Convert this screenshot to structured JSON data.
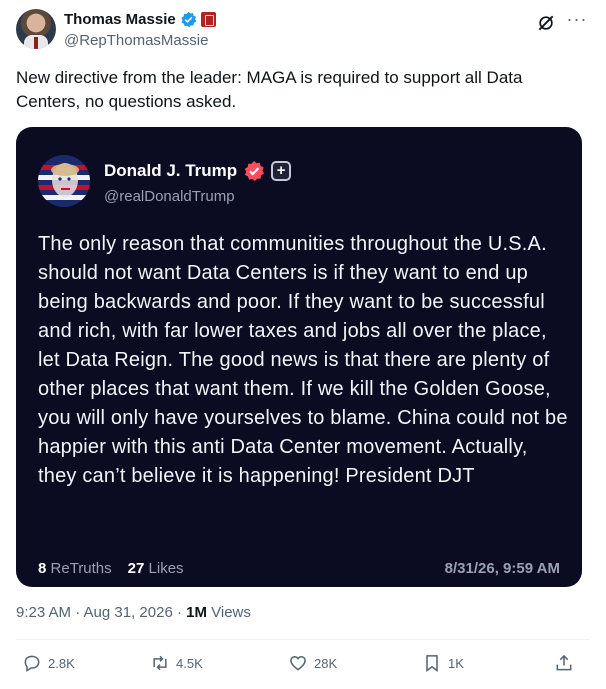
{
  "author": {
    "name": "Thomas Massie",
    "handle": "@RepThomasMassie"
  },
  "tweet": {
    "text": "New directive from the leader: MAGA is required to support all Data Centers, no questions asked."
  },
  "quoted_post": {
    "name": "Donald J. Trump",
    "handle": "@realDonaldTrump",
    "text": "The only reason that communities throughout the U.S.A. should not want Data Centers is if they want to end up being backwards and poor. If they want to be successful and rich, with far lower taxes and jobs all over the place, let Data Reign. The good news is that there are plenty of other places that want them. If we kill the Golden Goose, you will only have yourselves to blame. China could not be happier with this anti Data Center movement. Actually, they can’t believe it is happening! President DJT",
    "retruths_count": "8",
    "retruths_label": "ReTruths",
    "likes_count": "27",
    "likes_label": "Likes",
    "date": "8/31/26, 9:59 AM"
  },
  "meta": {
    "time": "9:23 AM · Aug 31, 2026 · ",
    "views_count": "1M",
    "views_label": " Views"
  },
  "actions": {
    "replies": "2.8K",
    "reposts": "4.5K",
    "likes": "28K",
    "bookmarks": "1K"
  },
  "colors": {
    "verified_blue": "#1d9bf0",
    "card_background": "#0b0b22",
    "truth_badge": "#ff4d5e"
  },
  "icons": [
    "verified-badge-icon",
    "government-badge-icon",
    "grok-icon",
    "more-icon",
    "reply-icon",
    "repost-icon",
    "like-icon",
    "bookmark-icon",
    "share-icon"
  ]
}
